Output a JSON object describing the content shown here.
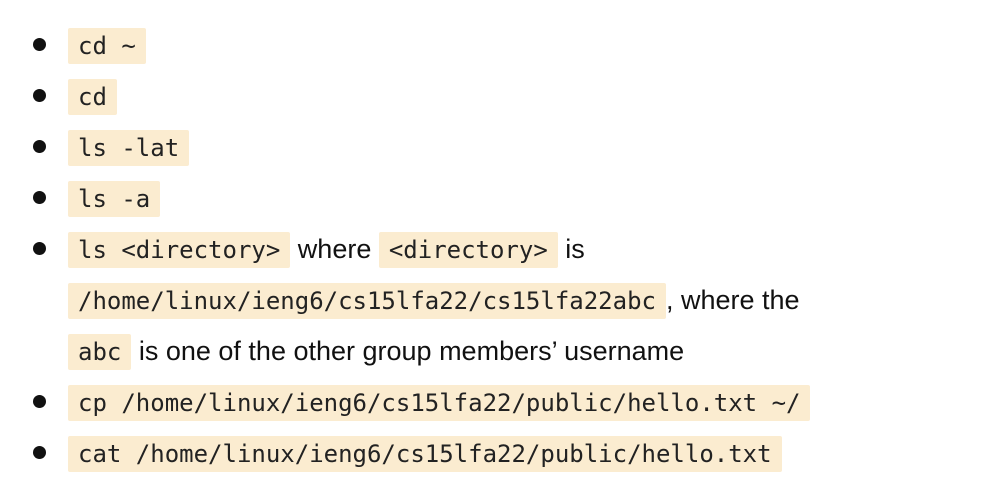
{
  "colors": {
    "code_background": "#fbecd0",
    "text": "#111111",
    "bullet": "#111111"
  },
  "items": [
    {
      "code": "cd ~"
    },
    {
      "code": "cd"
    },
    {
      "code": "ls -lat"
    },
    {
      "code": "ls -a"
    },
    {
      "parts": [
        {
          "code": "ls <directory>"
        },
        {
          "text": " where "
        },
        {
          "code": "<directory>"
        },
        {
          "text": " is "
        },
        {
          "code": "/home/linux/ieng6/cs15lfa22/cs15lfa22abc"
        },
        {
          "text": ", where the "
        },
        {
          "code": "abc"
        },
        {
          "text": " is one of the other group members’ username"
        }
      ]
    },
    {
      "code": "cp /home/linux/ieng6/cs15lfa22/public/hello.txt ~/"
    },
    {
      "code": "cat /home/linux/ieng6/cs15lfa22/public/hello.txt"
    }
  ]
}
